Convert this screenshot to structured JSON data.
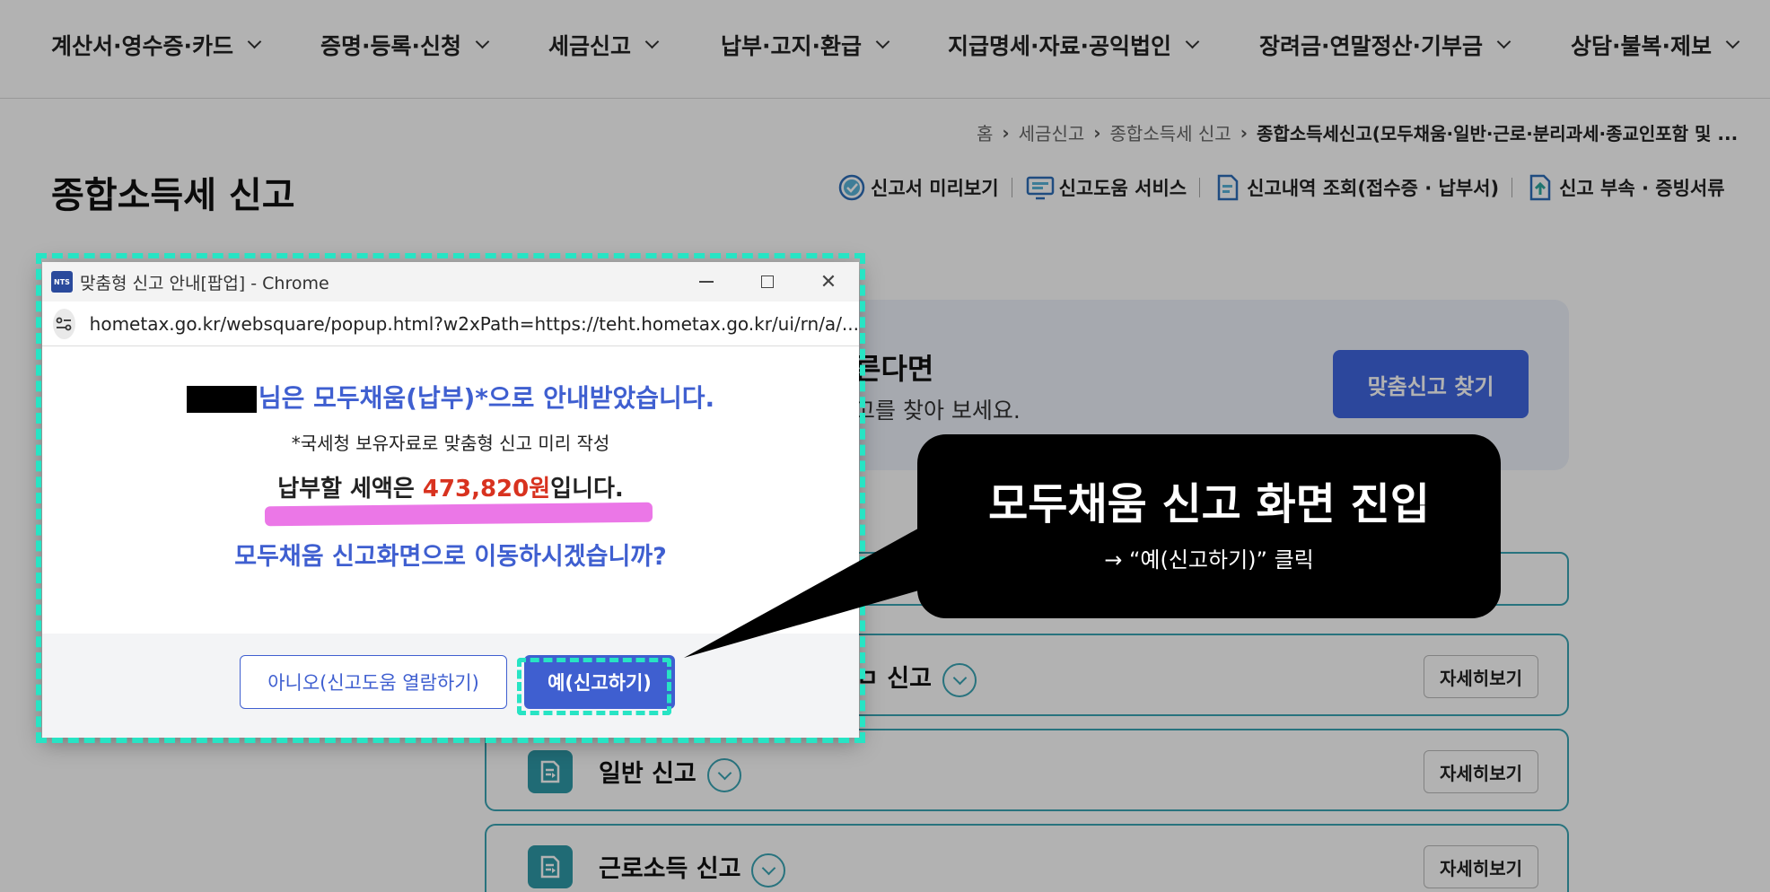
{
  "nav": {
    "items": [
      {
        "label": "계산서·영수증·카드"
      },
      {
        "label": "증명·등록·신청"
      },
      {
        "label": "세금신고"
      },
      {
        "label": "납부·고지·환급"
      },
      {
        "label": "지급명세·자료·공익법인"
      },
      {
        "label": "장려금·연말정산·기부금"
      },
      {
        "label": "상담·불복·제보"
      }
    ]
  },
  "breadcrumb": {
    "items": [
      "홈",
      "세금신고",
      "종합소득세 신고"
    ],
    "current": "종합소득세신고(모두채움·일반·근로·분리과세·종교인포함 및 ..."
  },
  "page": {
    "title": "종합소득세 신고"
  },
  "tools": [
    {
      "label": "신고서 미리보기",
      "icon": "check-circle-icon"
    },
    {
      "label": "신고도움 서비스",
      "icon": "monitor-help-icon"
    },
    {
      "label": "신고내역 조회(접수증 · 납부서)",
      "icon": "document-search-icon"
    },
    {
      "label": "신고 부속 · 증빙서류",
      "icon": "document-upload-icon"
    }
  ],
  "finder": {
    "title": "른다면",
    "desc": "고를 찾아 보세요.",
    "button": "맞춤신고 찾기"
  },
  "report_rows": [
    {
      "label": "ㅁ 신고"
    },
    {
      "label": "일반 신고"
    },
    {
      "label": "근로소득 신고"
    }
  ],
  "detail_label": "자세히보기",
  "popup": {
    "window_title": "맞춤형 신고 안내[팝업] - Chrome",
    "url": "hometax.go.kr/websquare/popup.html?w2xPath=https://teht.hometax.go.kr/ui/rn/a/...",
    "line1": "님은 모두채움(납부)*으로 안내받았습니다.",
    "line2": "*국세청 보유자료로 맞춤형 신고 미리 작성",
    "line3_prefix": "납부할 세액은 ",
    "amount": "473,820원",
    "line3_suffix": "입니다.",
    "line4": "모두채움 신고화면으로 이동하시겠습니까?",
    "btn_no": "아니오(신고도움 열람하기)",
    "btn_yes": "예(신고하기)"
  },
  "callout": {
    "title": "모두채움 신고 화면 진입",
    "subtitle": "→ “예(신고하기)” 클릭"
  },
  "colors": {
    "accent": "#3f5fd0",
    "teal": "#3aa5b5",
    "annotation": "#27e4c4",
    "amount": "#d8321f",
    "highlighter": "#e85fe3"
  }
}
